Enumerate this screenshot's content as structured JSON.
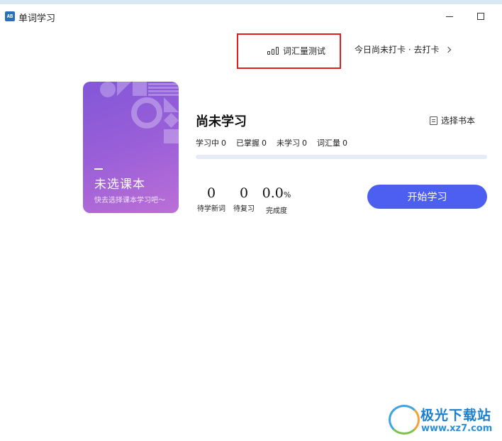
{
  "window": {
    "title": "单词学习",
    "app_icon_text": "AB"
  },
  "top_links": {
    "vocab_test": "词汇量测试",
    "checkin": "今日尚未打卡 · 去打卡"
  },
  "book": {
    "dash": "—",
    "title": "未选课本",
    "subtitle": "快去选择课本学习吧～"
  },
  "status": {
    "title": "尚未学习",
    "choose_book": "选择书本"
  },
  "stats": [
    {
      "label": "学习中",
      "value": "0"
    },
    {
      "label": "已掌握",
      "value": "0"
    },
    {
      "label": "未学习",
      "value": "0"
    },
    {
      "label": "词汇量",
      "value": "0"
    }
  ],
  "progress": {
    "value": 0
  },
  "metrics": {
    "new_words": {
      "value": "0",
      "label": "待学新词"
    },
    "review": {
      "value": "0",
      "label": "待复习"
    },
    "completion": {
      "value": "0.0",
      "unit": "%",
      "label": "完成度"
    }
  },
  "start_button": "开始学习",
  "watermark": {
    "name": "极光下载站",
    "url": "www.xz7.com"
  },
  "colors": {
    "accent": "#4c5ff0",
    "highlight": "#e0201c",
    "card_gradient_start": "#8257d8",
    "card_gradient_end": "#bb6fd6"
  },
  "icons": [
    "app-icon",
    "bar-chart-icon",
    "chevron-right-icon",
    "book-icon",
    "minimize-icon",
    "maximize-icon"
  ]
}
